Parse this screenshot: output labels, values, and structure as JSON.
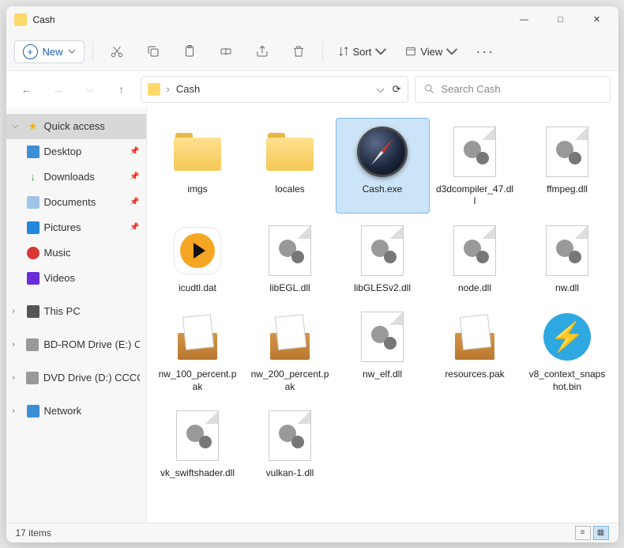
{
  "window": {
    "title": "Cash",
    "btn_min": "—",
    "btn_max": "□",
    "btn_close": "✕"
  },
  "toolbar": {
    "new_label": "New",
    "sort_label": "Sort",
    "view_label": "View"
  },
  "breadcrumb": {
    "root": "",
    "current": "Cash"
  },
  "search": {
    "placeholder": "Search Cash"
  },
  "sidebar": {
    "quick_access": "Quick access",
    "items": [
      {
        "label": "Desktop"
      },
      {
        "label": "Downloads"
      },
      {
        "label": "Documents"
      },
      {
        "label": "Pictures"
      },
      {
        "label": "Music"
      },
      {
        "label": "Videos"
      }
    ],
    "this_pc": "This PC",
    "bd": "BD-ROM Drive (E:) C",
    "dvd": "DVD Drive (D:) CCCO",
    "network": "Network"
  },
  "files": [
    {
      "name": "imgs",
      "type": "folder"
    },
    {
      "name": "locales",
      "type": "folder"
    },
    {
      "name": "Cash.exe",
      "type": "compass",
      "selected": true
    },
    {
      "name": "d3dcompiler_47.dll",
      "type": "dll"
    },
    {
      "name": "ffmpeg.dll",
      "type": "dll"
    },
    {
      "name": "icudtl.dat",
      "type": "play"
    },
    {
      "name": "libEGL.dll",
      "type": "dll"
    },
    {
      "name": "libGLESv2.dll",
      "type": "dll"
    },
    {
      "name": "node.dll",
      "type": "dll"
    },
    {
      "name": "nw.dll",
      "type": "dll"
    },
    {
      "name": "nw_100_percent.pak",
      "type": "box"
    },
    {
      "name": "nw_200_percent.pak",
      "type": "box"
    },
    {
      "name": "nw_elf.dll",
      "type": "dll"
    },
    {
      "name": "resources.pak",
      "type": "box"
    },
    {
      "name": "v8_context_snapshot.bin",
      "type": "bolt"
    },
    {
      "name": "vk_swiftshader.dll",
      "type": "dll"
    },
    {
      "name": "vulkan-1.dll",
      "type": "dll"
    }
  ],
  "status": {
    "text": "17 items"
  },
  "watermark": ""
}
